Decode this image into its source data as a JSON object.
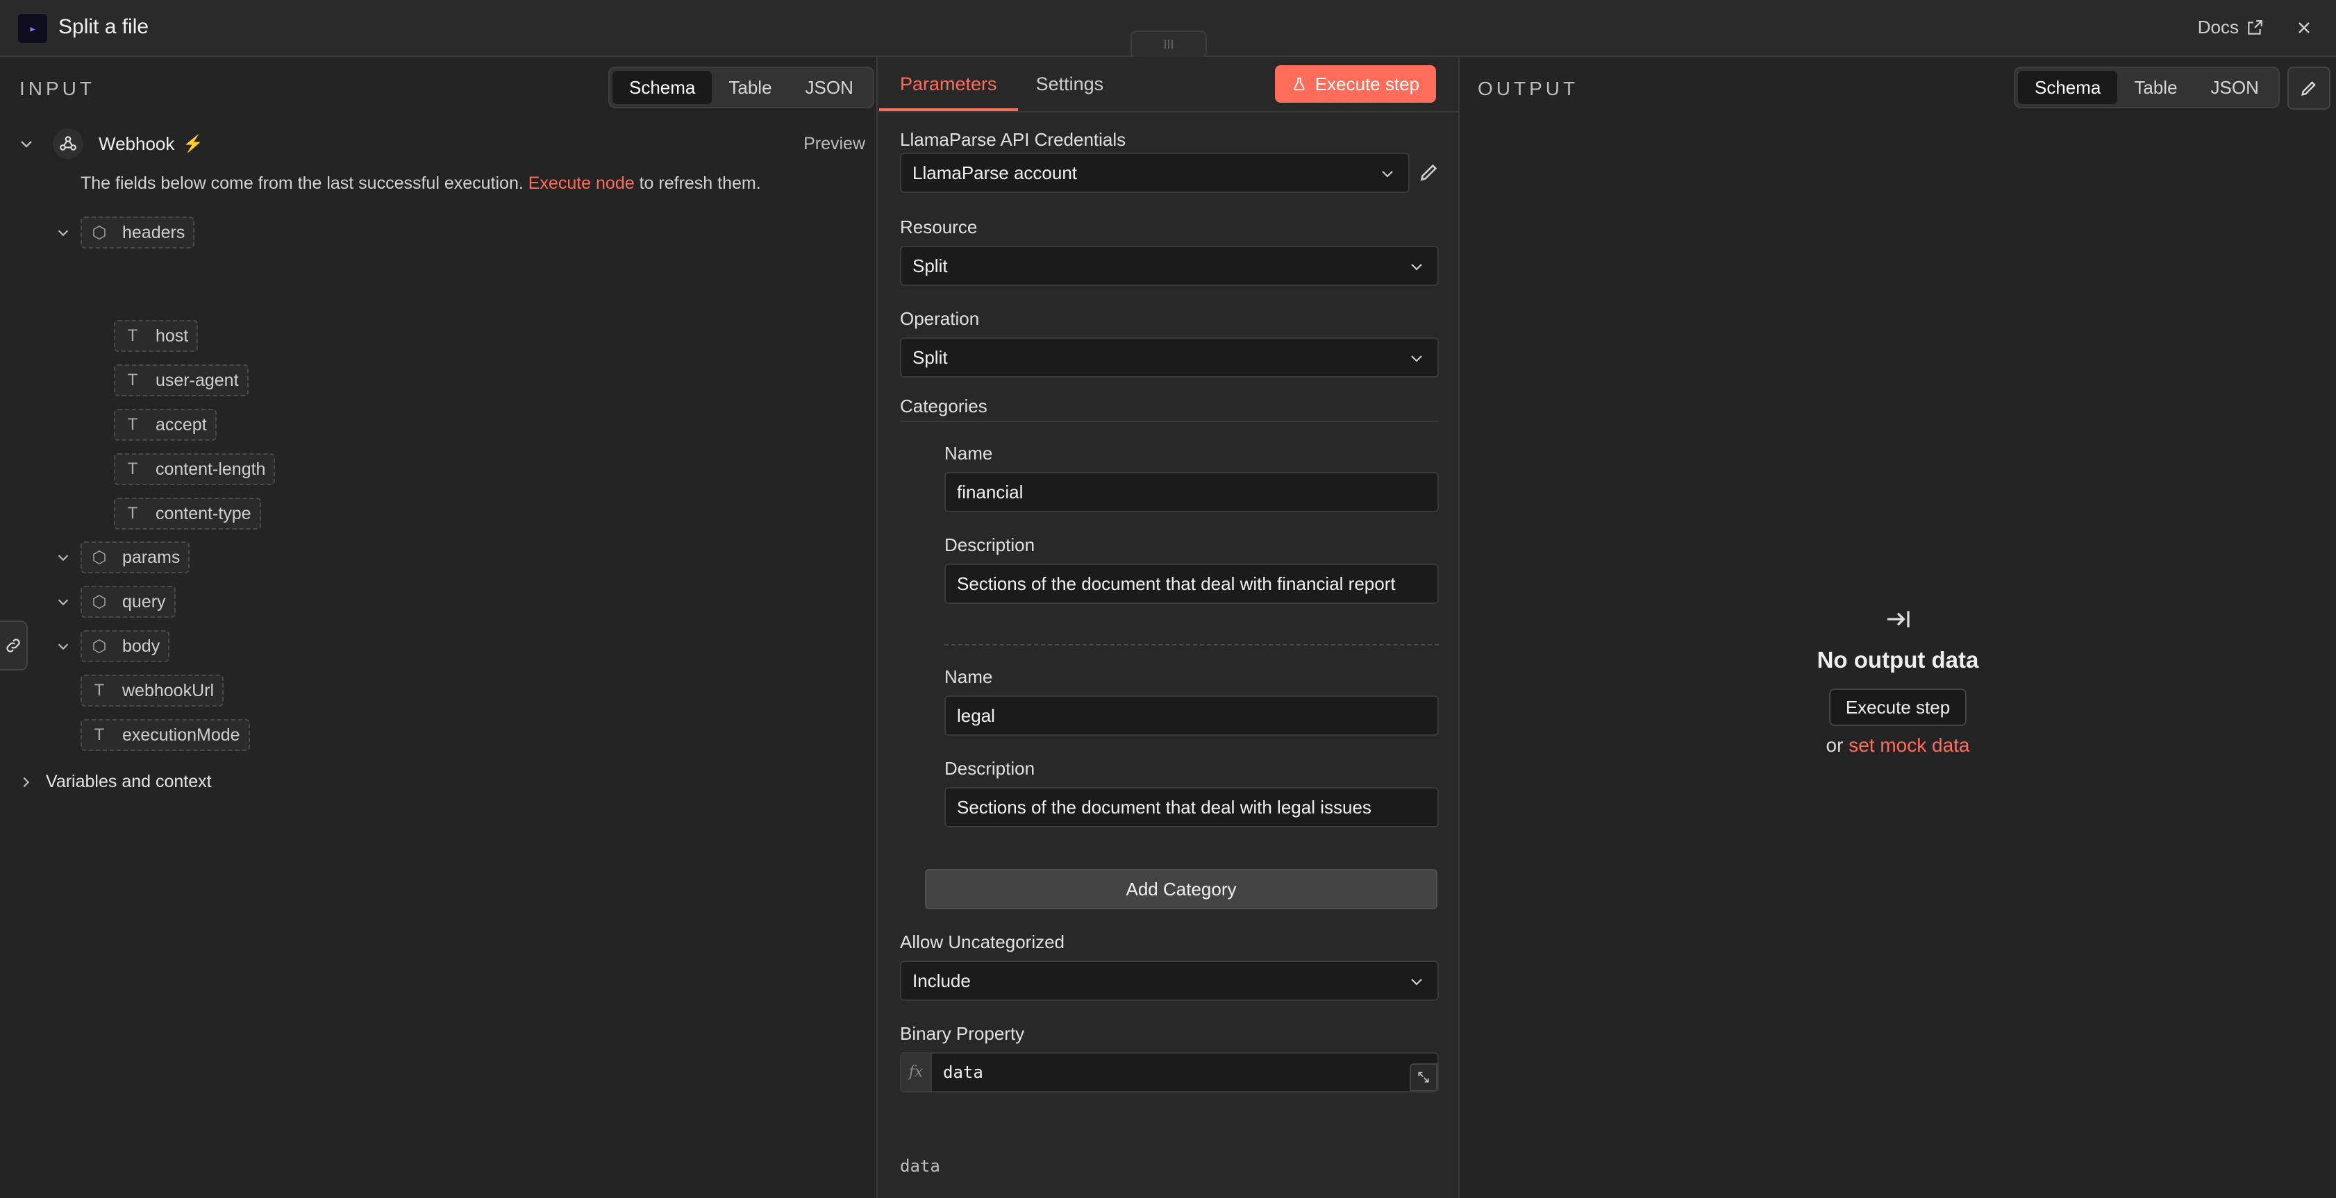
{
  "window": {
    "title": "Split a file",
    "docs_label": "Docs",
    "drag_handle": "III"
  },
  "input": {
    "heading": "INPUT",
    "view_tabs": [
      "Schema",
      "Table",
      "JSON"
    ],
    "active_view": "Schema",
    "node_name": "Webhook",
    "preview_label": "Preview",
    "hint_prefix": "The fields below come from the last successful execution.",
    "hint_link": "Execute node",
    "hint_suffix": "to refresh them.",
    "fields": {
      "headers": "headers",
      "host": "host",
      "user_agent": "user-agent",
      "accept": "accept",
      "content_length": "content-length",
      "content_type": "content-type",
      "params": "params",
      "query": "query",
      "body": "body",
      "webhookUrl": "webhookUrl",
      "executionMode": "executionMode"
    },
    "variables_label": "Variables and context"
  },
  "params": {
    "tabs": {
      "parameters": "Parameters",
      "settings": "Settings"
    },
    "execute_label": "Execute step",
    "credentials_label": "LlamaParse API Credentials",
    "credentials_value": "LlamaParse account",
    "resource_label": "Resource",
    "resource_value": "Split",
    "operation_label": "Operation",
    "operation_value": "Split",
    "categories_label": "Categories",
    "categories": [
      {
        "name_label": "Name",
        "name": "financial",
        "desc_label": "Description",
        "description": "Sections of the document that deal with financial report"
      },
      {
        "name_label": "Name",
        "name": "legal",
        "desc_label": "Description",
        "description": "Sections of the document that deal with legal issues"
      }
    ],
    "add_category_label": "Add Category",
    "allow_uncat_label": "Allow Uncategorized",
    "allow_uncat_value": "Include",
    "binary_label": "Binary Property",
    "binary_value": "data",
    "binary_preview": "data",
    "fx_label": "fx"
  },
  "output": {
    "heading": "OUTPUT",
    "view_tabs": [
      "Schema",
      "Table",
      "JSON"
    ],
    "active_view": "Schema",
    "no_output_title": "No output data",
    "execute_label": "Execute step",
    "or_label": "or",
    "mock_link": "set mock data"
  },
  "colors": {
    "accent": "#ff6d5a",
    "panel_bg": "#242424",
    "input_bg": "#1b1b1b"
  }
}
